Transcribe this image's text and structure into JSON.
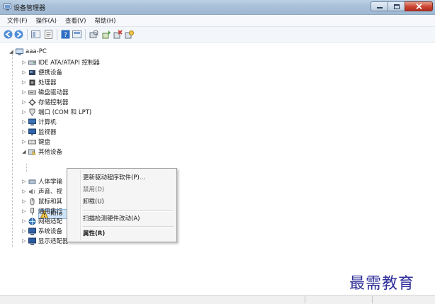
{
  "window": {
    "title": "设备管理器",
    "controls": [
      "minimize-icon",
      "maximize-icon",
      "close-icon"
    ]
  },
  "menu": [
    "文件(F)",
    "操作(A)",
    "查看(V)",
    "帮助(H)"
  ],
  "toolbar": {
    "icons": [
      "back-arrow-icon",
      "forward-arrow-icon",
      "view-icon",
      "properties-icon",
      "help-icon",
      "show-hidden-icon",
      "scan-hardware-icon",
      "update-driver-icon",
      "uninstall-icon",
      "disable-icon"
    ]
  },
  "tree": {
    "root": "aaa-PC",
    "items": [
      {
        "label": "IDE ATA/ATAPI 控制器",
        "icon": "ide-controller-icon"
      },
      {
        "label": "便携设备",
        "icon": "portable-device-icon"
      },
      {
        "label": "处理器",
        "icon": "processor-icon"
      },
      {
        "label": "磁盘驱动器",
        "icon": "disk-drive-icon"
      },
      {
        "label": "存储控制器",
        "icon": "storage-controller-icon"
      },
      {
        "label": "端口 (COM 和 LPT)",
        "icon": "port-icon"
      },
      {
        "label": "计算机",
        "icon": "computer-icon"
      },
      {
        "label": "监视器",
        "icon": "monitor-icon"
      },
      {
        "label": "键盘",
        "icon": "keyboard-icon"
      },
      {
        "label": "其他设备",
        "icon": "other-devices-icon"
      },
      {
        "label": "Kno",
        "icon": "unknown-device-icon",
        "selected": true
      },
      {
        "label": "人体学输",
        "icon": "hid-icon"
      },
      {
        "label": "声音、视",
        "icon": "sound-icon"
      },
      {
        "label": "鼠标和其",
        "icon": "mouse-icon"
      },
      {
        "label": "通用串行",
        "icon": "usb-icon"
      },
      {
        "label": "网络适配",
        "icon": "network-adapter-icon"
      },
      {
        "label": "系统设备",
        "icon": "system-device-icon"
      },
      {
        "label": "显示适配器",
        "icon": "display-adapter-icon"
      }
    ]
  },
  "context_menu": {
    "items": [
      {
        "label": "更新驱动程序软件(P)...",
        "disabled": false
      },
      {
        "label": "禁用(D)",
        "disabled": true
      },
      {
        "label": "卸载(U)",
        "disabled": false
      },
      {
        "label": "扫描检测硬件改动(A)",
        "disabled": false
      },
      {
        "label": "属性(R)",
        "disabled": false,
        "bold": true
      }
    ]
  },
  "watermark": "最需教育"
}
